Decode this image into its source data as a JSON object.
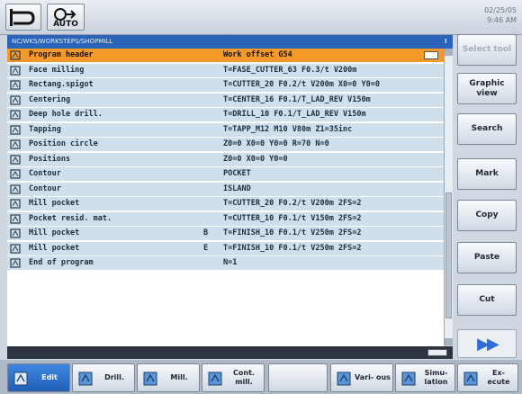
{
  "topbar": {
    "auto_label": "AUTO",
    "clock_date": "02/25/05",
    "clock_time": "9:46 AM"
  },
  "path": {
    "text": "NC/WKS/WORKSTEPS/SHOPMILL",
    "indicator": "!"
  },
  "program_rows": [
    {
      "icon": "program-header-icon",
      "name": "Program header",
      "marker": "",
      "params": "Work offset G54",
      "selected": true
    },
    {
      "icon": "face-milling-icon",
      "name": "Face milling",
      "marker": "",
      "params": "T=FASE_CUTTER_63 F0.3/t V200m"
    },
    {
      "icon": "rect-spigot-icon",
      "name": "Rectang.spigot",
      "marker": "",
      "params": "T=CUTTER_20 F0.2/t V200m X0=0 Y0=0"
    },
    {
      "icon": "centering-icon",
      "name": "Centering",
      "marker": "",
      "params": "T=CENTER_16 F0.1/T_LAD_REV V150m"
    },
    {
      "icon": "deep-hole-drill-icon",
      "name": "Deep hole drill.",
      "marker": "",
      "params": "T=DRILL_10 F0.1/T_LAD_REV V150m"
    },
    {
      "icon": "tapping-icon",
      "name": "Tapping",
      "marker": "",
      "params": "T=TAPP_M12 M10 V80m Z1=35inc"
    },
    {
      "icon": "position-circle-icon",
      "name": "Position circle",
      "marker": "",
      "params": "Z0=0 X0=0 Y0=0 R=70 N=0"
    },
    {
      "icon": "positions-icon",
      "name": "Positions",
      "marker": "",
      "params": "Z0=0 X0=0 Y0=0"
    },
    {
      "icon": "contour-icon",
      "name": "Contour",
      "marker": "",
      "params": "POCKET"
    },
    {
      "icon": "contour-icon",
      "name": "Contour",
      "marker": "",
      "params": "ISLAND"
    },
    {
      "icon": "mill-pocket-icon",
      "name": "Mill pocket",
      "marker": "",
      "params": "T=CUTTER_20 F0.2/t V200m 2FS=2"
    },
    {
      "icon": "pocket-resid-icon",
      "name": "Pocket resid. mat.",
      "marker": "",
      "params": "T=CUTTER_10 F0.1/t V150m 2FS=2"
    },
    {
      "icon": "mill-pocket-icon",
      "name": "Mill pocket",
      "marker": "B",
      "params": "T=FINISH_10 F0.1/t V250m 2FS=2"
    },
    {
      "icon": "mill-pocket-icon",
      "name": "Mill pocket",
      "marker": "E",
      "params": "T=FINISH_10 F0.1/t V250m 2FS=2"
    },
    {
      "icon": "end-program-icon",
      "name": "End of program",
      "marker": "",
      "params": "N=1"
    }
  ],
  "right_softkeys": [
    {
      "label": "Select tool",
      "enabled": false
    },
    {
      "label": "Graphic view",
      "enabled": true
    },
    {
      "label": "Search",
      "enabled": true
    },
    {
      "label": "Mark",
      "enabled": true
    },
    {
      "label": "Copy",
      "enabled": true
    },
    {
      "label": "Paste",
      "enabled": true
    },
    {
      "label": "Cut",
      "enabled": true
    }
  ],
  "bottom_softkeys": [
    {
      "label": "Edit",
      "icon": "edit-icon",
      "active": true
    },
    {
      "label": "Drill.",
      "icon": "drill-icon"
    },
    {
      "label": "Mill.",
      "icon": "mill-icon"
    },
    {
      "label": "Cont. mill.",
      "icon": "contour-mill-icon"
    },
    {
      "label": "",
      "icon": ""
    },
    {
      "label": "Vari- ous",
      "icon": "various-icon"
    },
    {
      "label": "Simu- lation",
      "icon": "simulation-icon"
    },
    {
      "label": "Ex- ecute",
      "icon": "execute-icon"
    }
  ],
  "colors": {
    "selected_row": "#f59a2a",
    "row_bg": "#cfe0ec",
    "path_bar": "#2a63b8",
    "active_softkey": "#2f74d0"
  }
}
